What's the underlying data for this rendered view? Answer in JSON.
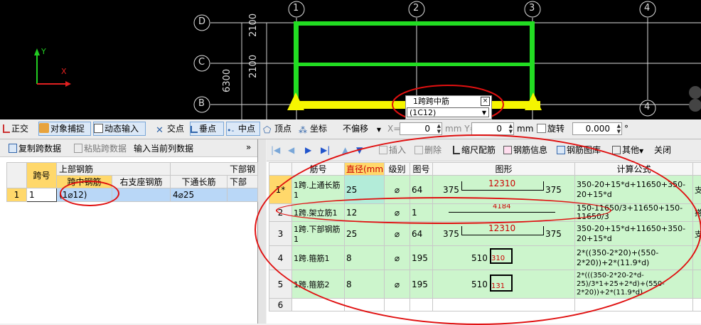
{
  "cad": {
    "axis_x_label": "X",
    "axis_y_label": "Y",
    "grid_top": [
      "1",
      "2",
      "3",
      "4"
    ],
    "grid_left": [
      "D",
      "C",
      "B"
    ],
    "grid_bottom": [
      "4"
    ],
    "dim_vertical": [
      "2100",
      "2100",
      "6300"
    ],
    "popup_title": "1跨跨中筋",
    "popup_close": "×",
    "popup_value": "(1C12)",
    "colors": {
      "beam": "#22dd22",
      "span": "#f5f500",
      "grid": "#ffffff",
      "highlight": "#e01010"
    }
  },
  "toolbar": {
    "orthogonal": "正交",
    "snap": "对象捕捉",
    "dynamic_input": "动态输入",
    "intersection": "交点",
    "perpendicular": "垂点",
    "midpoint": "中点",
    "vertex": "顶点",
    "coordinate": "坐标",
    "offset_mode": "不偏移",
    "x_label": "X=",
    "x_value": "0",
    "unit1": "mm Y=",
    "y_value": "0",
    "unit2": "mm",
    "rotate_label": "旋转",
    "rotate_value": "0.000",
    "degree": "°"
  },
  "left_toolbar": {
    "copy": "复制跨数据",
    "paste": "粘贴跨数据",
    "input_col": "输入当前列数据",
    "more": "»"
  },
  "left_grid": {
    "h_span": "跨号",
    "h_top": "上部钢筋",
    "h_bottom": "下部钢",
    "h_mid": "跨中钢筋",
    "h_right_support": "右支座钢筋",
    "h_bottom_long": "下通长筋",
    "h_bottom_sub": "下部",
    "rows": [
      {
        "no": "1",
        "span": "1",
        "mid": "(1⌀12)",
        "bottom_long": "4⌀25",
        "bottom": ""
      }
    ]
  },
  "right_toolbar": {
    "insert": "插入",
    "delete": "删除",
    "scale": "缩尺配筋",
    "info": "钢筋信息",
    "lib": "钢筋图库",
    "other": "其他",
    "close": "关闭"
  },
  "right_grid": {
    "headers": {
      "name": "筋号",
      "dia": "直径(mm)",
      "grade": "级别",
      "fig": "图号",
      "shape": "图形",
      "formula": "计算公式"
    },
    "rows": [
      {
        "no": "1*",
        "name": "1跨.上通长筋1",
        "dia": "25",
        "grade": "⌀",
        "fig": "64",
        "left": "375",
        "len": "12310",
        "right": "375",
        "formula": "350-20+15*d+11650+350-20+15*d",
        "extra": "支"
      },
      {
        "no": "2",
        "name": "1跨.架立筋1",
        "dia": "12",
        "grade": "⌀",
        "fig": "1",
        "left": "",
        "len": "4184",
        "right": "",
        "formula": "150-11650/3+11650+150-11650/3",
        "extra": "搭"
      },
      {
        "no": "3",
        "name": "1跨.下部钢筋1",
        "dia": "25",
        "grade": "⌀",
        "fig": "64",
        "left": "375",
        "len": "12310",
        "right": "375",
        "formula": "350-20+15*d+11650+350-20+15*d",
        "extra": "支"
      },
      {
        "no": "4",
        "name": "1跨.箍筋1",
        "dia": "8",
        "grade": "⌀",
        "fig": "195",
        "left": "510",
        "len": "310",
        "right": "",
        "formula": "2*((350-2*20)+(550-2*20))+2*(11.9*d)",
        "extra": ""
      },
      {
        "no": "5",
        "name": "1跨.箍筋2",
        "dia": "8",
        "grade": "⌀",
        "fig": "195",
        "left": "510",
        "len": "131",
        "right": "",
        "formula": "2*(((350-2*20-2*d-25)/3*1+25+2*d)+(550-2*20))+2*(11.9*d)",
        "extra": ""
      },
      {
        "no": "6",
        "name": "",
        "dia": "",
        "grade": "",
        "fig": "",
        "left": "",
        "len": "",
        "right": "",
        "formula": "",
        "extra": ""
      }
    ]
  }
}
